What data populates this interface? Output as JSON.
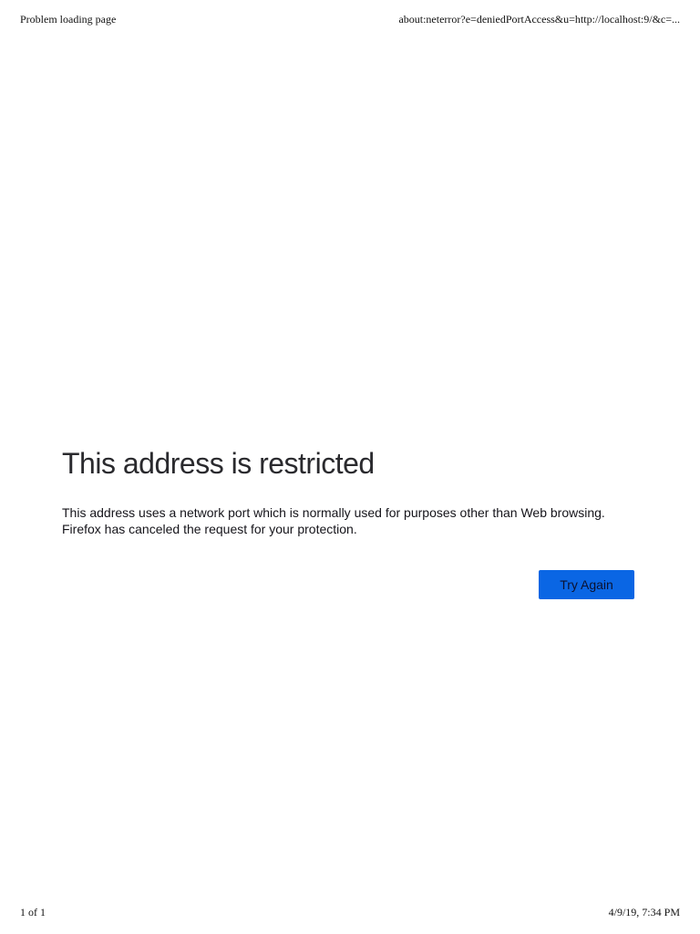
{
  "print_header": {
    "title": "Problem loading page",
    "url": "about:neterror?e=deniedPortAccess&u=http://localhost:9/&c=..."
  },
  "error": {
    "title": "This address is restricted",
    "description_line1": "This address uses a network port which is normally used for purposes other than Web browsing.",
    "description_line2": "Firefox has canceled the request for your protection.",
    "try_again_label": "Try Again"
  },
  "print_footer": {
    "page_count": "1 of 1",
    "timestamp": "4/9/19, 7:34 PM"
  },
  "colors": {
    "button_background": "#0a66e4",
    "title_text": "#2a2a2e",
    "body_text": "#15141a"
  }
}
